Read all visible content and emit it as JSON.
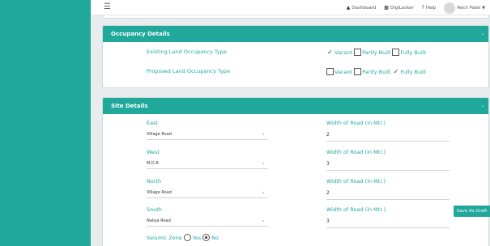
{
  "topbar": {
    "menu_icon": "hamburger-icon",
    "dashboard": "Dashboard",
    "digilocker": "DigiLocker",
    "help": "Help",
    "user_name": "Rech Patel"
  },
  "occupancy": {
    "title": "Occupancy Details",
    "rows": [
      {
        "label": "Existing Land Occupancy Type",
        "options": [
          {
            "label": "Vacant",
            "checked": true
          },
          {
            "label": "Partly Built",
            "checked": false
          },
          {
            "label": "Fully Built",
            "checked": false
          }
        ]
      },
      {
        "label": "Proposed Land Occupancy Type",
        "options": [
          {
            "label": "Vacant",
            "checked": false
          },
          {
            "label": "Partly Built",
            "checked": false
          },
          {
            "label": "Fully Built",
            "checked": true
          }
        ]
      }
    ]
  },
  "site": {
    "title": "Site Details",
    "rows": [
      {
        "dir": "East",
        "road_type": "Village Road",
        "width_label": "Width of Road (in Mtr.)",
        "width": "2"
      },
      {
        "dir": "West",
        "road_type": "M.D.R",
        "width_label": "Width of Road (in Mtr.)",
        "width": "3"
      },
      {
        "dir": "North",
        "road_type": "Village Road",
        "width_label": "Width of Road (in Mtr.)",
        "width": "2"
      },
      {
        "dir": "South",
        "road_type": "Naliya Road",
        "width_label": "Width of Road (in Mtr.)",
        "width": "3"
      }
    ],
    "seismic": {
      "label": "Seismic Zone",
      "yes": "Yes",
      "no": "No",
      "selected": "No"
    }
  },
  "save_draft": "Save As Draft",
  "colors": {
    "accent": "#20a89a",
    "background": "#e9ecef"
  }
}
